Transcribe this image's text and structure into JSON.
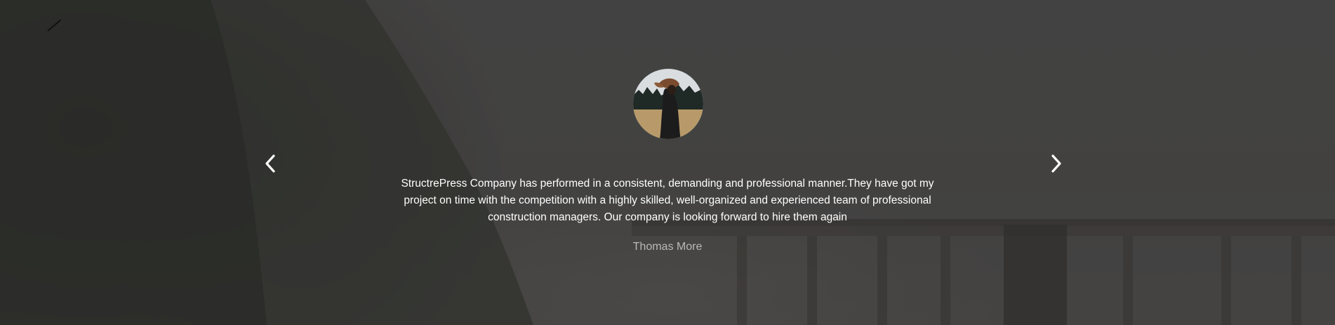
{
  "testimonial": {
    "quote": "StructrePress Company has performed in a consistent, demanding and professional manner.They have got my project on time with the competition with a highly skilled, well-organized and experienced team of professional construction managers. Our company is looking forward to hire them again",
    "author": "Thomas More"
  },
  "navigation": {
    "prev_icon": "chevron-left-icon",
    "next_icon": "chevron-right-icon"
  },
  "colors": {
    "text": "#ffffff",
    "author": "#b9b9b9",
    "overlay": "#3f3f3f"
  }
}
